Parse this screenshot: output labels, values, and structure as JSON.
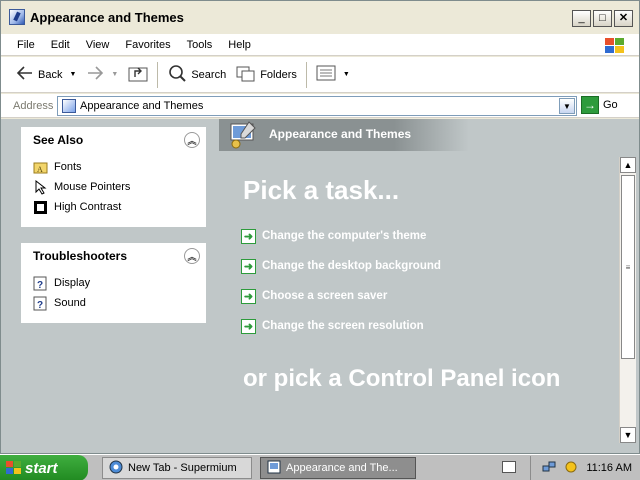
{
  "window": {
    "title": "Appearance and Themes",
    "buttons": [
      "minimize",
      "maximize",
      "close"
    ]
  },
  "menu": [
    "File",
    "Edit",
    "View",
    "Favorites",
    "Tools",
    "Help"
  ],
  "toolbar": {
    "back_label": "Back",
    "search_label": "Search",
    "folders_label": "Folders"
  },
  "address": {
    "label": "Address",
    "value": "Appearance and Themes",
    "go_label": "Go"
  },
  "see_also": {
    "title": "See Also",
    "items": [
      {
        "label": "Fonts",
        "icon": "folder-fonts-icon"
      },
      {
        "label": "Mouse Pointers",
        "icon": "mouse-pointer-icon"
      },
      {
        "label": "High Contrast",
        "icon": "high-contrast-icon"
      }
    ]
  },
  "troubleshooters": {
    "title": "Troubleshooters",
    "items": [
      {
        "label": "Display",
        "icon": "help-icon"
      },
      {
        "label": "Sound",
        "icon": "help-icon"
      }
    ]
  },
  "main": {
    "header": "Appearance and Themes",
    "pick_task": "Pick a task...",
    "tasks": [
      "Change the computer's theme",
      "Change the desktop background",
      "Choose a screen saver",
      "Change the screen resolution"
    ],
    "pick_icon": "or pick a Control Panel icon"
  },
  "taskbar": {
    "start_label": "start",
    "tasks": [
      {
        "label": "New Tab - Supermium",
        "active": false
      },
      {
        "label": "Appearance and The...",
        "active": true
      }
    ],
    "clock": "11:16 AM"
  },
  "colors": {
    "content_bg": "#C0C7C8",
    "start_green": "#2E9B3C"
  }
}
